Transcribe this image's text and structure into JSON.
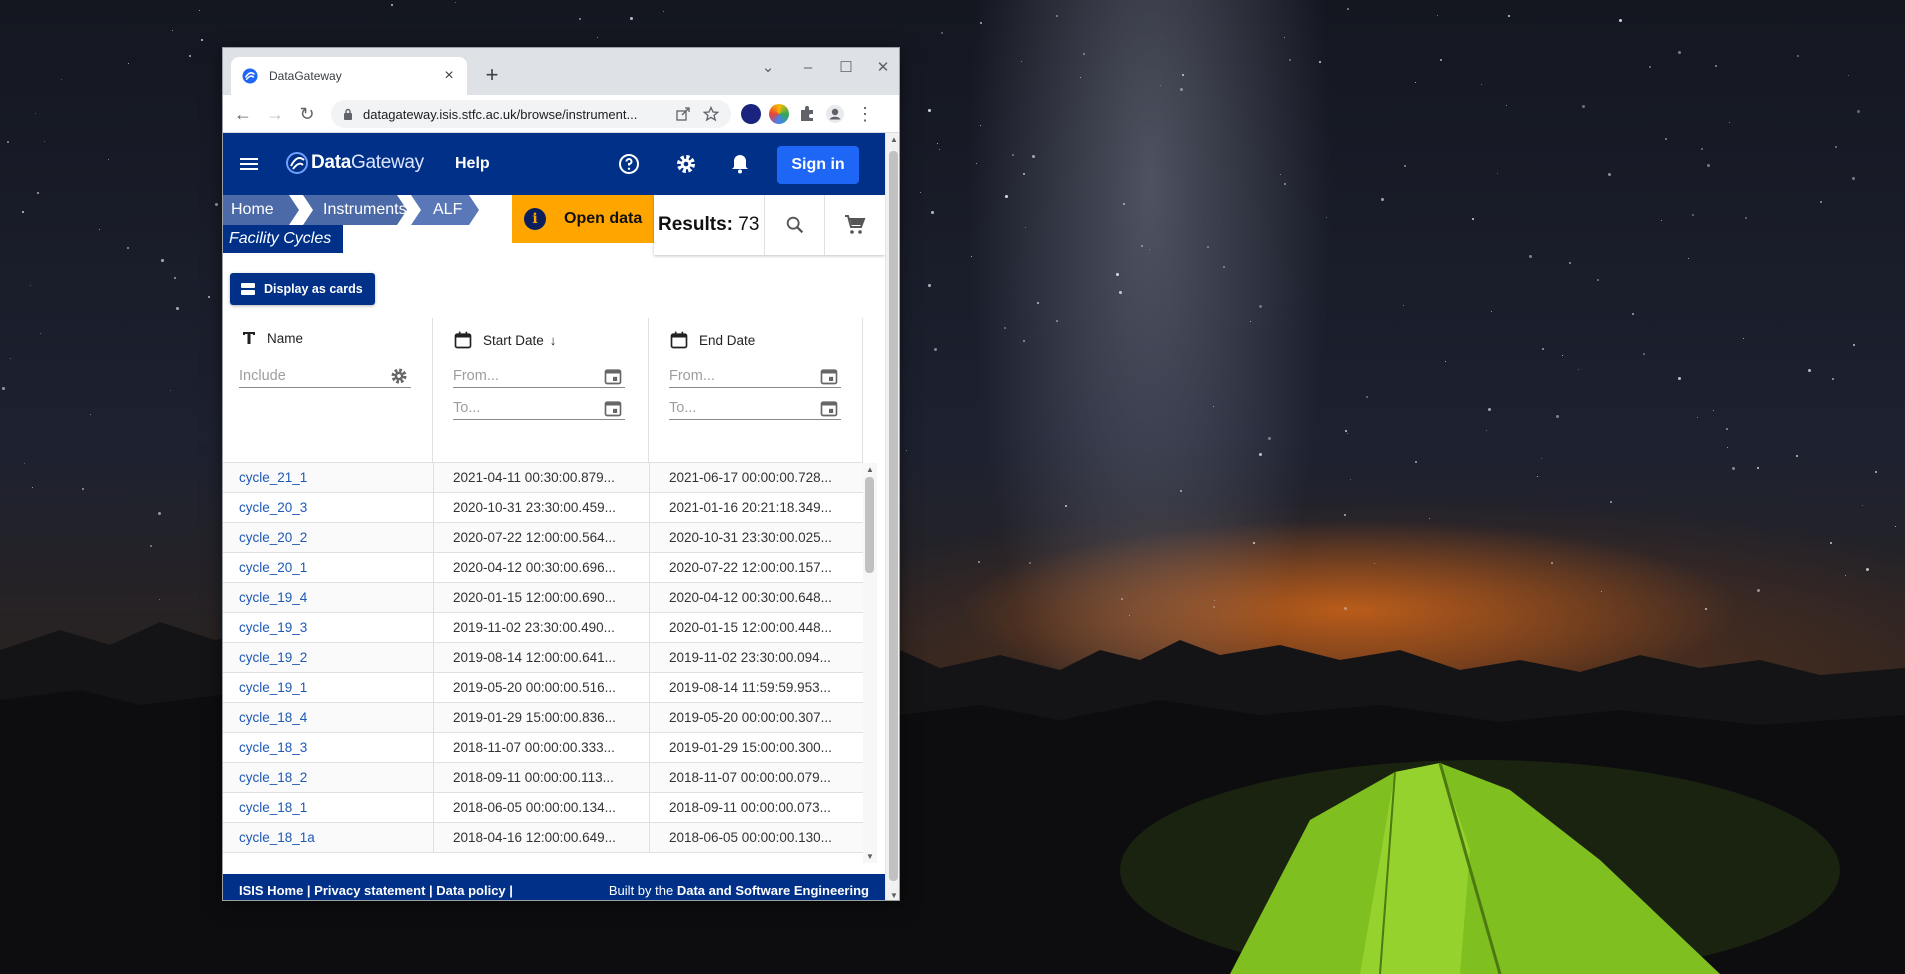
{
  "browser": {
    "tab_title": "DataGateway",
    "tab_close": "×",
    "new_tab": "+",
    "url": "datagateway.isis.stfc.ac.uk/browse/instrument...",
    "window_controls": [
      "⌄",
      "–",
      "☐",
      "✕"
    ],
    "nav": [
      "←",
      "→",
      "↻"
    ],
    "menu": "⋮"
  },
  "app": {
    "brand_bold": "Data",
    "brand_light": "Gateway",
    "help": "Help",
    "sign_in": "Sign in"
  },
  "breadcrumbs": [
    "Home",
    "Instruments",
    "ALF"
  ],
  "current_page": "Facility Cycles",
  "open_data": {
    "icon": "i",
    "label": "Open data"
  },
  "results": {
    "label": "Results:",
    "count": "73"
  },
  "display_button": "Display as cards",
  "columns": {
    "name": {
      "title": "Name",
      "placeholder": "Include"
    },
    "start": {
      "title": "Start Date",
      "sort": "↓",
      "from": "From...",
      "to": "To..."
    },
    "end": {
      "title": "End Date",
      "from": "From...",
      "to": "To..."
    }
  },
  "rows": [
    {
      "name": "cycle_21_1",
      "start": "2021-04-11 00:30:00.879...",
      "end": "2021-06-17 00:00:00.728..."
    },
    {
      "name": "cycle_20_3",
      "start": "2020-10-31 23:30:00.459...",
      "end": "2021-01-16 20:21:18.349..."
    },
    {
      "name": "cycle_20_2",
      "start": "2020-07-22 12:00:00.564...",
      "end": "2020-10-31 23:30:00.025..."
    },
    {
      "name": "cycle_20_1",
      "start": "2020-04-12 00:30:00.696...",
      "end": "2020-07-22 12:00:00.157..."
    },
    {
      "name": "cycle_19_4",
      "start": "2020-01-15 12:00:00.690...",
      "end": "2020-04-12 00:30:00.648..."
    },
    {
      "name": "cycle_19_3",
      "start": "2019-11-02 23:30:00.490...",
      "end": "2020-01-15 12:00:00.448..."
    },
    {
      "name": "cycle_19_2",
      "start": "2019-08-14 12:00:00.641...",
      "end": "2019-11-02 23:30:00.094..."
    },
    {
      "name": "cycle_19_1",
      "start": "2019-05-20 00:00:00.516...",
      "end": "2019-08-14 11:59:59.953..."
    },
    {
      "name": "cycle_18_4",
      "start": "2019-01-29 15:00:00.836...",
      "end": "2019-05-20 00:00:00.307..."
    },
    {
      "name": "cycle_18_3",
      "start": "2018-11-07 00:00:00.333...",
      "end": "2019-01-29 15:00:00.300..."
    },
    {
      "name": "cycle_18_2",
      "start": "2018-09-11 00:00:00.113...",
      "end": "2018-11-07 00:00:00.079..."
    },
    {
      "name": "cycle_18_1",
      "start": "2018-06-05 00:00:00.134...",
      "end": "2018-09-11 00:00:00.073..."
    },
    {
      "name": "cycle_18_1a",
      "start": "2018-04-16 12:00:00.649...",
      "end": "2018-06-05 00:00:00.130..."
    }
  ],
  "footer": {
    "left": "ISIS Home | Privacy statement | Data policy |",
    "right_prefix": "Built by the",
    "right_bold": "Data and Software Engineering"
  },
  "colors": {
    "appbar": "#003088",
    "accent_orange": "#ffa500",
    "sign_in": "#1e66f5",
    "link": "#1e58b5"
  },
  "icons": [
    "menu-icon",
    "help-icon",
    "gear-icon",
    "bell-icon",
    "search-icon",
    "cart-icon",
    "calendar-icon",
    "text-type-icon",
    "cards-icon",
    "info-icon",
    "lock-icon",
    "share-icon",
    "star-icon",
    "puzzle-icon",
    "profile-icon"
  ]
}
